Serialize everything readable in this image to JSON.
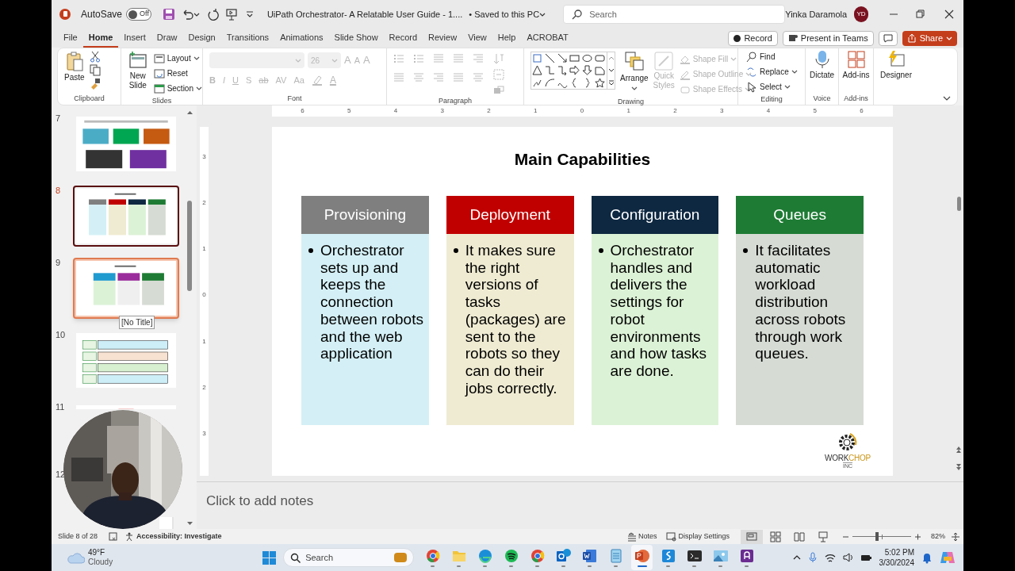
{
  "window": {
    "autosave_label": "AutoSave",
    "autosave": {
      "on": false,
      "label": "Off"
    },
    "title": "UiPath Orchestrator- A Relatable User Guide - 1....",
    "save_status": "• Saved to this PC",
    "search_placeholder": "Search",
    "user_name": "Yinka Daramola",
    "user_initials": "YD"
  },
  "ribbon_tabs": [
    {
      "label": "File",
      "selected": false
    },
    {
      "label": "Home",
      "selected": true
    },
    {
      "label": "Insert",
      "selected": false
    },
    {
      "label": "Draw",
      "selected": false
    },
    {
      "label": "Design",
      "selected": false
    },
    {
      "label": "Transitions",
      "selected": false
    },
    {
      "label": "Animations",
      "selected": false
    },
    {
      "label": "Slide Show",
      "selected": false
    },
    {
      "label": "Record",
      "selected": false
    },
    {
      "label": "Review",
      "selected": false
    },
    {
      "label": "View",
      "selected": false
    },
    {
      "label": "Help",
      "selected": false
    },
    {
      "label": "ACROBAT",
      "selected": false
    }
  ],
  "ribbon_buttons": {
    "record": "Record",
    "present": "Present in Teams",
    "share": "Share"
  },
  "ribbon": {
    "clipboard": {
      "label": "Clipboard",
      "paste": "Paste"
    },
    "slides": {
      "label": "Slides",
      "new_slide": "New Slide",
      "layout": "Layout",
      "reset": "Reset",
      "section": "Section"
    },
    "font": {
      "label": "Font",
      "size": "26",
      "disabled": true,
      "grow_glyph": "A",
      "shrink_glyph": "A",
      "clear_glyph": "A",
      "style_glyphs": [
        "B",
        "I",
        "U",
        "S",
        "ab",
        "AV",
        "Aa"
      ],
      "color_glyph": "A"
    },
    "paragraph": {
      "label": "Paragraph",
      "disabled": true
    },
    "drawing": {
      "label": "Drawing",
      "arrange": "Arrange",
      "quick_styles": {
        "label": "Quick Styles",
        "disabled": true
      },
      "shape_commands": [
        {
          "label": "Shape Fill",
          "disabled": true
        },
        {
          "label": "Shape Outline",
          "disabled": true
        },
        {
          "label": "Shape Effects",
          "disabled": true
        }
      ]
    },
    "editing": {
      "label": "Editing",
      "commands": [
        "Find",
        "Replace",
        "Select"
      ]
    },
    "voice": {
      "label": "Voice",
      "dictate": "Dictate"
    },
    "addins": {
      "label": "Add-ins",
      "addins": "Add-ins"
    },
    "designer": {
      "designer": "Designer"
    }
  },
  "thumbnails": [
    {
      "number": "7",
      "selected": false,
      "hovered": false
    },
    {
      "number": "8",
      "selected": true,
      "hovered": false
    },
    {
      "number": "9",
      "selected": false,
      "hovered": true
    },
    {
      "number": "10",
      "selected": false,
      "hovered": false
    },
    {
      "number": "11",
      "selected": false,
      "hovered": false
    },
    {
      "number": "12",
      "selected": false,
      "hovered": false
    }
  ],
  "tooltip": "[No Title]",
  "rulers": {
    "horizontal": [
      "6",
      "5",
      "4",
      "3",
      "2",
      "1",
      "0",
      "1",
      "2",
      "3",
      "4",
      "5",
      "6"
    ],
    "vertical": [
      "3",
      "2",
      "1",
      "0",
      "1",
      "2",
      "3"
    ]
  },
  "slide": {
    "title": "Main Capabilities",
    "columns": [
      {
        "heading": "Provisioning",
        "color": "#7f7f7f",
        "body": {
          "color": "#d4f0f6",
          "text": "Orchestrator sets up and keeps the connection between robots and the web application"
        }
      },
      {
        "heading": "Deployment",
        "color": "#c00000",
        "body": {
          "color": "#efebd2",
          "text": "It makes sure the right versions of tasks (packages) are sent to the robots so they can do their jobs correctly."
        }
      },
      {
        "heading": "Configuration",
        "color": "#0e2841",
        "body": {
          "color": "#dcf2d6",
          "text": "Orchestrator handles and delivers the settings for robot environments and how tasks are done."
        }
      },
      {
        "heading": "Queues",
        "color": "#1e7b34",
        "body": {
          "color": "#d6dcd4",
          "text": "It facilitates automatic workload distribution across robots through work queues."
        }
      }
    ],
    "logo": {
      "parts": [
        "WORK",
        "CHOP"
      ],
      "sub": "INC"
    }
  },
  "notes": {
    "placeholder": "Click to add notes"
  },
  "status_bar": {
    "slide_indicator": "Slide 8 of 28",
    "accessibility": "Accessibility: Investigate",
    "notes": "Notes",
    "display_settings": "Display Settings",
    "views": [
      {
        "selected": true
      },
      {
        "selected": false
      },
      {
        "selected": false
      },
      {
        "selected": false
      }
    ],
    "zoom": {
      "level": 0.42,
      "reading": "82%"
    }
  },
  "taskbar": {
    "weather": {
      "temperature": "49°F",
      "condition": "Cloudy"
    },
    "search_placeholder": "Search",
    "apps": [
      {
        "selected": false
      },
      {
        "selected": false
      },
      {
        "selected": false
      },
      {
        "selected": false
      },
      {
        "selected": false
      },
      {
        "selected": false
      },
      {
        "selected": false
      },
      {
        "selected": false
      },
      {
        "selected": true
      },
      {
        "selected": false
      },
      {
        "selected": false
      },
      {
        "selected": false
      },
      {
        "selected": false
      }
    ],
    "time": "5:02 PM",
    "date": "3/30/2024"
  }
}
